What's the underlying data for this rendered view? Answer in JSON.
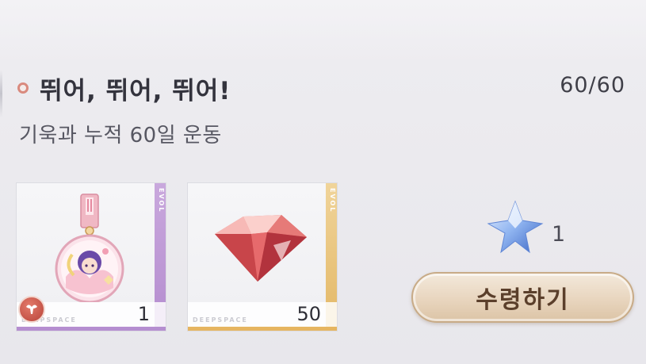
{
  "achievement": {
    "title": "뛰어, 뛰어, 뛰어!",
    "subtitle": "기욱과 누적 60일 운동",
    "progress": "60/60"
  },
  "rewards": [
    {
      "item": "medal-pendant-icon",
      "brand": "DEEPSPACE",
      "tag": "EVOL",
      "count": "1",
      "accent": "#b58ed0"
    },
    {
      "item": "red-diamond-icon",
      "brand": "DEEPSPACE",
      "tag": "EVOL",
      "count": "50",
      "accent": "#e6b560"
    }
  ],
  "bonus": {
    "item": "blue-star-icon",
    "count": "1"
  },
  "claim_button": {
    "label": "수령하기"
  }
}
